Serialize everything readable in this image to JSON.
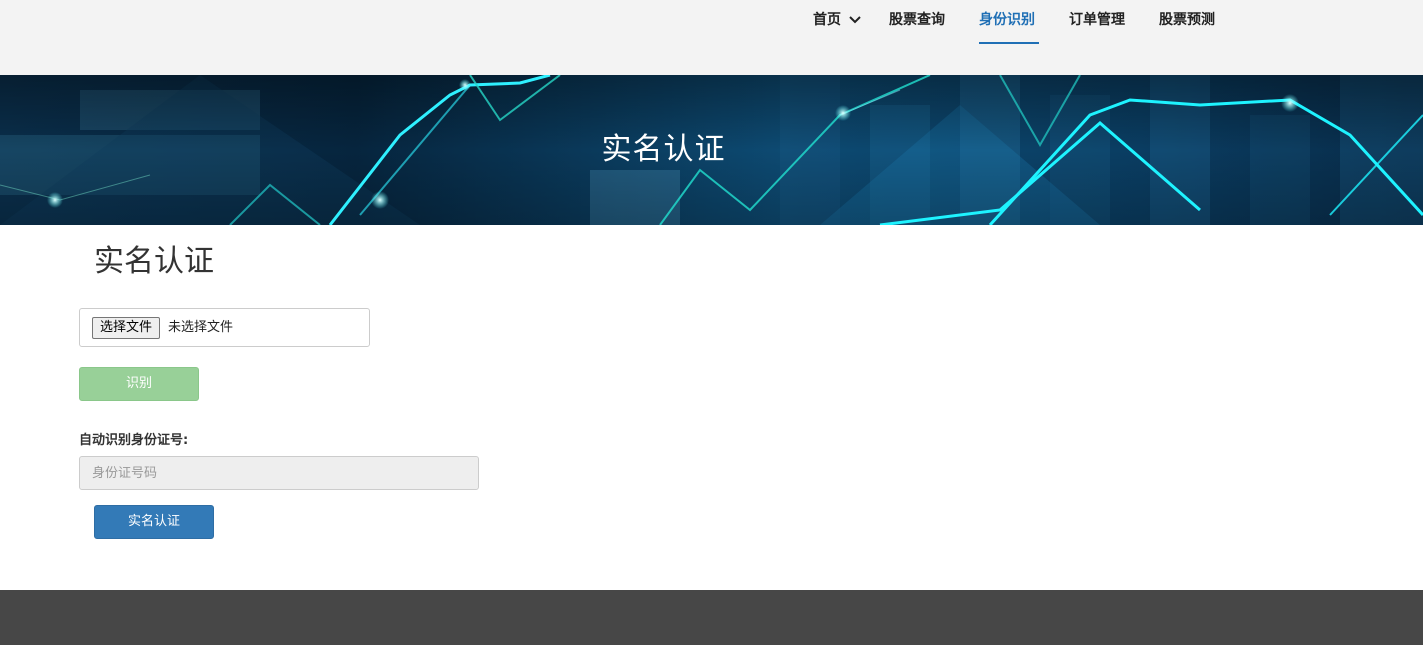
{
  "nav": {
    "items": [
      {
        "label": "首页",
        "has_dropdown": true,
        "active": false
      },
      {
        "label": "股票查询",
        "active": false
      },
      {
        "label": "身份识别",
        "active": true
      },
      {
        "label": "订单管理",
        "active": false
      },
      {
        "label": "股票预测",
        "active": false
      }
    ],
    "active_color": "#1f6fb5"
  },
  "banner": {
    "title": "实名认证"
  },
  "main": {
    "heading": "实名认证",
    "file_upload": {
      "button_label": "选择文件",
      "status_text": "未选择文件"
    },
    "recognize_button": "识别",
    "id_field": {
      "label": "自动识别身份证号:",
      "placeholder": "身份证号码",
      "value": ""
    },
    "submit_button": "实名认证"
  },
  "colors": {
    "recognize_button": "#98d098",
    "submit_button": "#337ab7",
    "footer": "#474747",
    "topbar": "#f3f3f3"
  }
}
